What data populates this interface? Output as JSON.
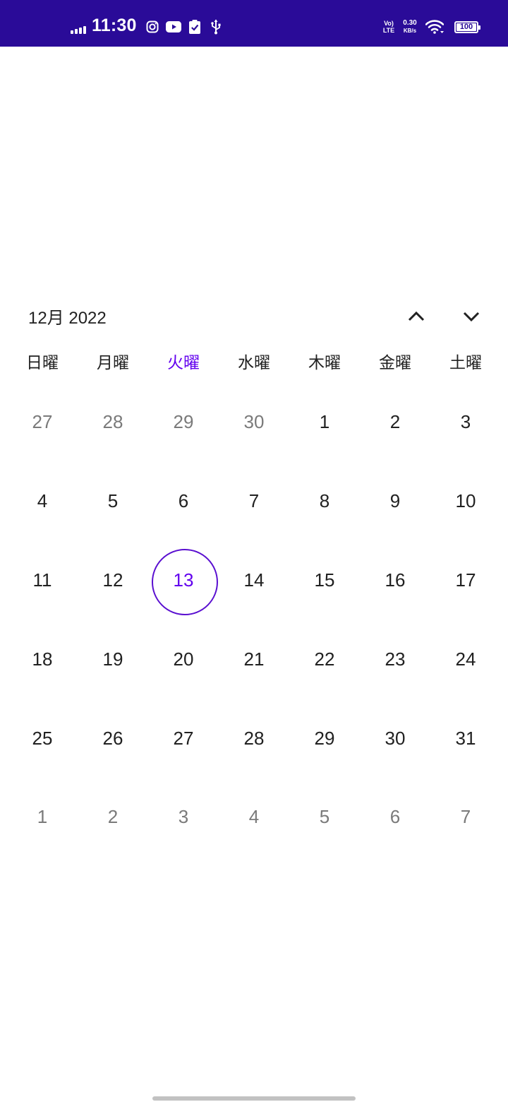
{
  "status_bar": {
    "time": "11:30",
    "volte_line1": "Vo)",
    "volte_line2": "LTE",
    "net_speed_value": "0.30",
    "net_speed_unit": "KB/s",
    "battery": "100",
    "icons": [
      "signal-icon",
      "instagram-icon",
      "youtube-icon",
      "clipboard-check-icon",
      "usb-icon",
      "wifi-icon",
      "battery-icon"
    ],
    "background_color": "#2a0b98"
  },
  "calendar": {
    "month_label": "12月 2022",
    "prev_icon": "chevron-up-icon",
    "next_icon": "chevron-down-icon",
    "accent_color": "#6200ee",
    "weekdays": [
      "日曜",
      "月曜",
      "火曜",
      "水曜",
      "木曜",
      "金曜",
      "土曜"
    ],
    "today_weekday_index": 2,
    "weeks": [
      [
        {
          "d": "27",
          "other": true
        },
        {
          "d": "28",
          "other": true
        },
        {
          "d": "29",
          "other": true
        },
        {
          "d": "30",
          "other": true
        },
        {
          "d": "1"
        },
        {
          "d": "2"
        },
        {
          "d": "3"
        }
      ],
      [
        {
          "d": "4"
        },
        {
          "d": "5"
        },
        {
          "d": "6"
        },
        {
          "d": "7"
        },
        {
          "d": "8"
        },
        {
          "d": "9"
        },
        {
          "d": "10"
        }
      ],
      [
        {
          "d": "11"
        },
        {
          "d": "12"
        },
        {
          "d": "13",
          "today": true
        },
        {
          "d": "14"
        },
        {
          "d": "15"
        },
        {
          "d": "16"
        },
        {
          "d": "17"
        }
      ],
      [
        {
          "d": "18"
        },
        {
          "d": "19"
        },
        {
          "d": "20"
        },
        {
          "d": "21"
        },
        {
          "d": "22"
        },
        {
          "d": "23"
        },
        {
          "d": "24"
        }
      ],
      [
        {
          "d": "25"
        },
        {
          "d": "26"
        },
        {
          "d": "27"
        },
        {
          "d": "28"
        },
        {
          "d": "29"
        },
        {
          "d": "30"
        },
        {
          "d": "31"
        }
      ],
      [
        {
          "d": "1",
          "other": true
        },
        {
          "d": "2",
          "other": true
        },
        {
          "d": "3",
          "other": true
        },
        {
          "d": "4",
          "other": true
        },
        {
          "d": "5",
          "other": true
        },
        {
          "d": "6",
          "other": true
        },
        {
          "d": "7",
          "other": true
        }
      ]
    ]
  }
}
